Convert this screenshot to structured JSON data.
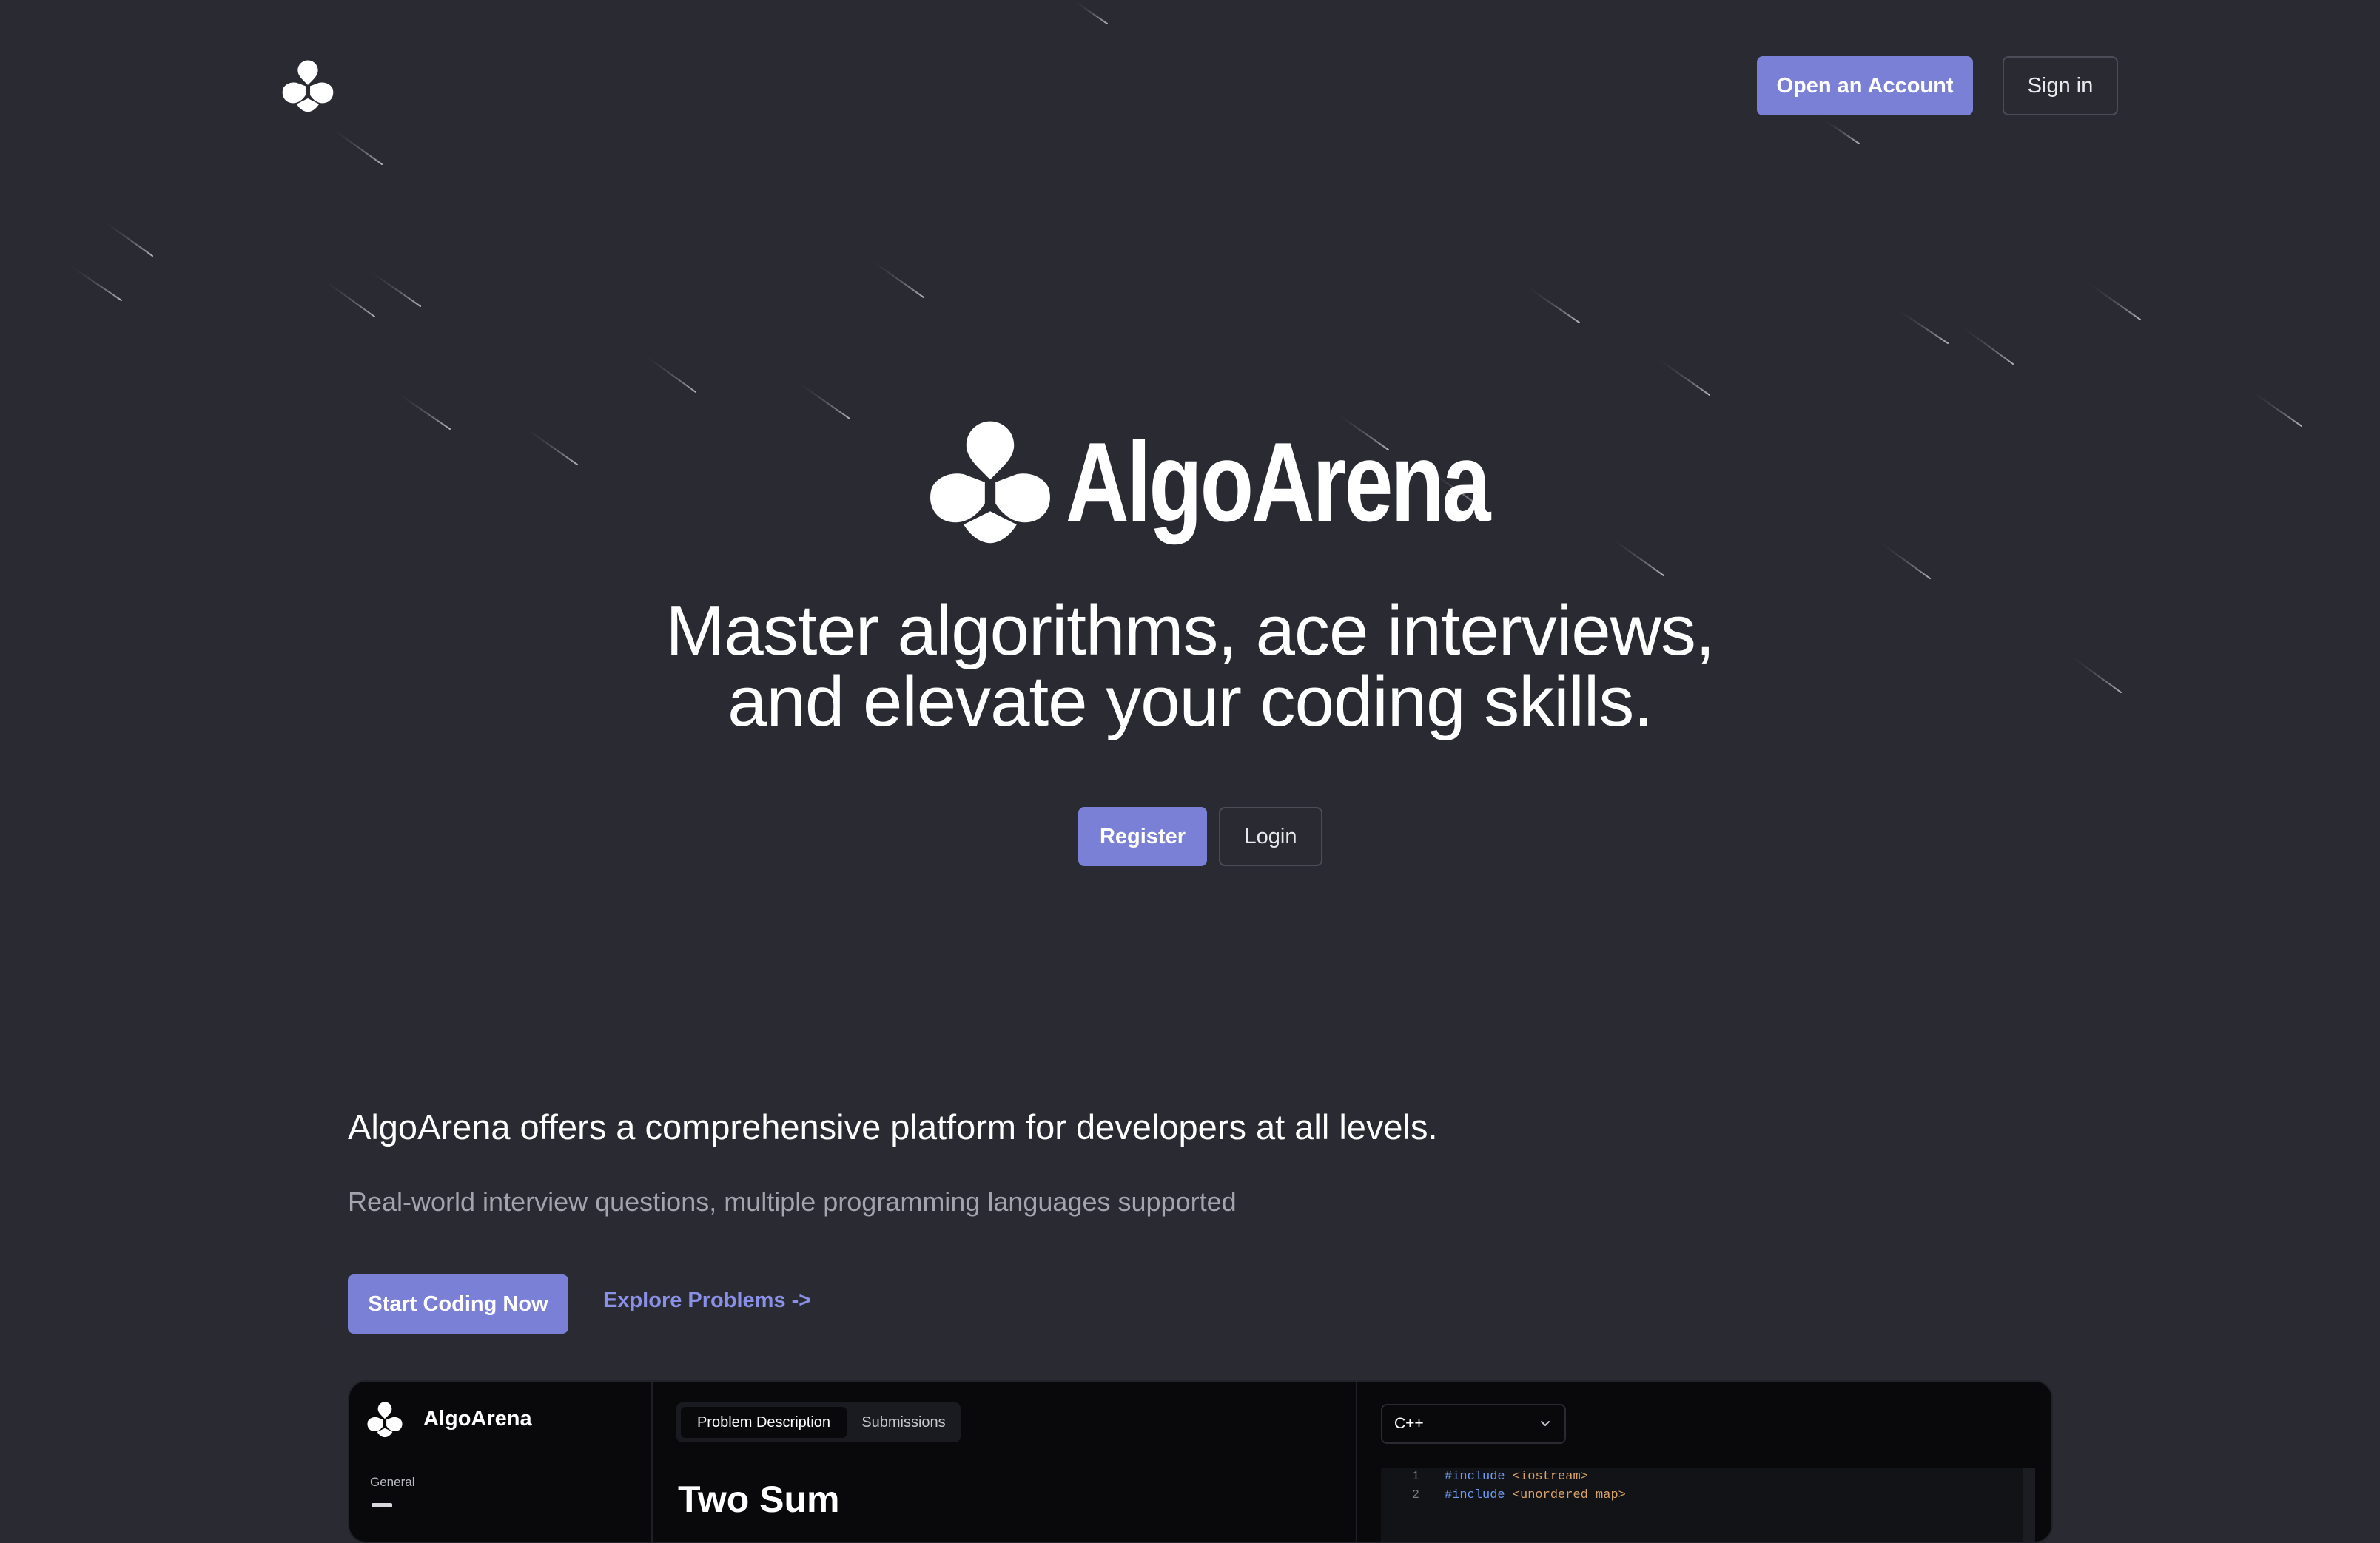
{
  "nav": {
    "logo_icon": "algoarena-logo-icon",
    "open_account_label": "Open an Account",
    "sign_in_label": "Sign in"
  },
  "hero": {
    "brand_name": "AlgoArena",
    "tagline_line1": "Master algorithms, ace interviews,",
    "tagline_line2": "and elevate your coding skills.",
    "register_label": "Register",
    "login_label": "Login"
  },
  "features": {
    "title": "AlgoArena offers a comprehensive platform for developers at all levels.",
    "subtitle": "Real-world interview questions, multiple programming languages supported",
    "start_label": "Start Coding Now",
    "explore_label": "Explore Problems ->"
  },
  "preview": {
    "brand_name": "AlgoArena",
    "sidebar_section": "General",
    "tabs": [
      {
        "label": "Problem Description"
      },
      {
        "label": "Submissions"
      }
    ],
    "problem_title": "Two Sum",
    "language": "C++",
    "code_lines": [
      {
        "num": "1",
        "keyword": "#include",
        "target": "<iostream>"
      },
      {
        "num": "2",
        "keyword": "#include",
        "target": "<unordered_map>"
      }
    ]
  },
  "colors": {
    "background": "#2a2b32",
    "accent": "#7a80d6",
    "link": "#8a90e6",
    "preview_bg": "#09090b"
  }
}
